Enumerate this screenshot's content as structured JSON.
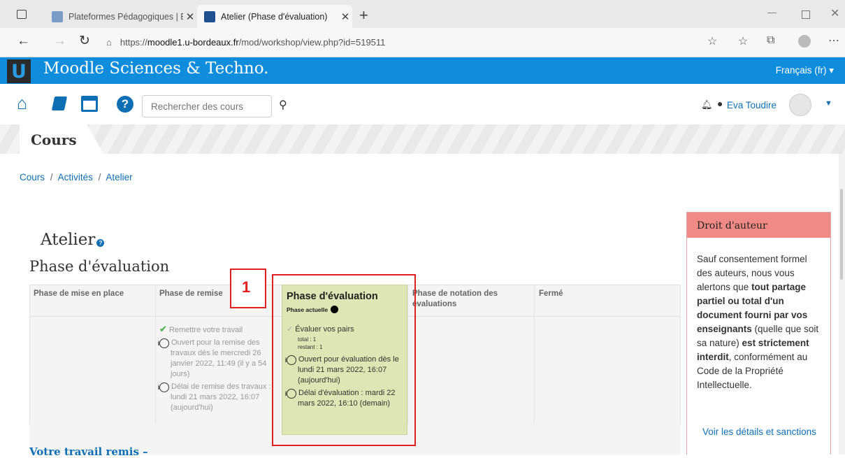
{
  "browser": {
    "tabs": [
      {
        "label": "Plateformes Pédagogiques | ENT",
        "favicon_color": "#7a9cc6"
      },
      {
        "label": "Atelier (Phase d'évaluation)",
        "favicon_color": "#1f4f8f"
      }
    ],
    "url_prefix": "https://",
    "url_domain": "moodle1.u-bordeaux.fr",
    "url_path": "/mod/workshop/view.php?id=519511"
  },
  "header": {
    "brand": "Moodle Sciences & Techno.",
    "language": "Français (fr) ▾",
    "color": "#0f8ddc"
  },
  "nav": {
    "search_placeholder": "Rechercher des cours",
    "user_name": "Eva Toudire"
  },
  "banner": {
    "title": "Cours"
  },
  "breadcrumb": [
    "Cours",
    "Activités",
    "Atelier"
  ],
  "page": {
    "title": "Atelier",
    "subtitle": "Phase d'évaluation",
    "annotation_number": "1"
  },
  "phases": [
    {
      "title": "Phase de mise en place"
    },
    {
      "title": "Phase de remise",
      "tasks": [
        {
          "text": "Remettre votre travail"
        },
        {
          "text": "Ouvert pour la remise des travaux dès le mercredi 26 janvier 2022, 11:49 (il y a 54 jours)"
        },
        {
          "text": "Délai de remise des travaux : lundi 21 mars 2022, 16:07 (aujourd'hui)"
        }
      ]
    },
    {
      "title": "Phase d'évaluation",
      "current_label": "Phase actuelle",
      "tasks": [
        {
          "text": "Évaluer vos pairs"
        },
        {
          "text": "Ouvert pour évaluation dès le lundi 21 mars 2022, 16:07 (aujourd'hui)"
        },
        {
          "text": "Délai d'évaluation : mardi 22 mars 2022, 16:10 (demain)"
        }
      ],
      "total": "total : 1",
      "remaining": "restant : 1"
    },
    {
      "title": "Phase de notation des évaluations"
    },
    {
      "title": "Fermé"
    }
  ],
  "footer_link": "Votre travail remis",
  "sidebar": {
    "title": "Droit d'auteur",
    "text_parts": [
      "Sauf consentement formel des auteurs, nous vous alertons que ",
      "tout partage partiel ou total d'un document fourni par vos enseignants",
      " (quelle que soit sa nature) ",
      "est strictement interdit",
      ", conformément au Code de la Propriété Intellectuelle."
    ],
    "link": "Voir les détails et sanctions"
  }
}
